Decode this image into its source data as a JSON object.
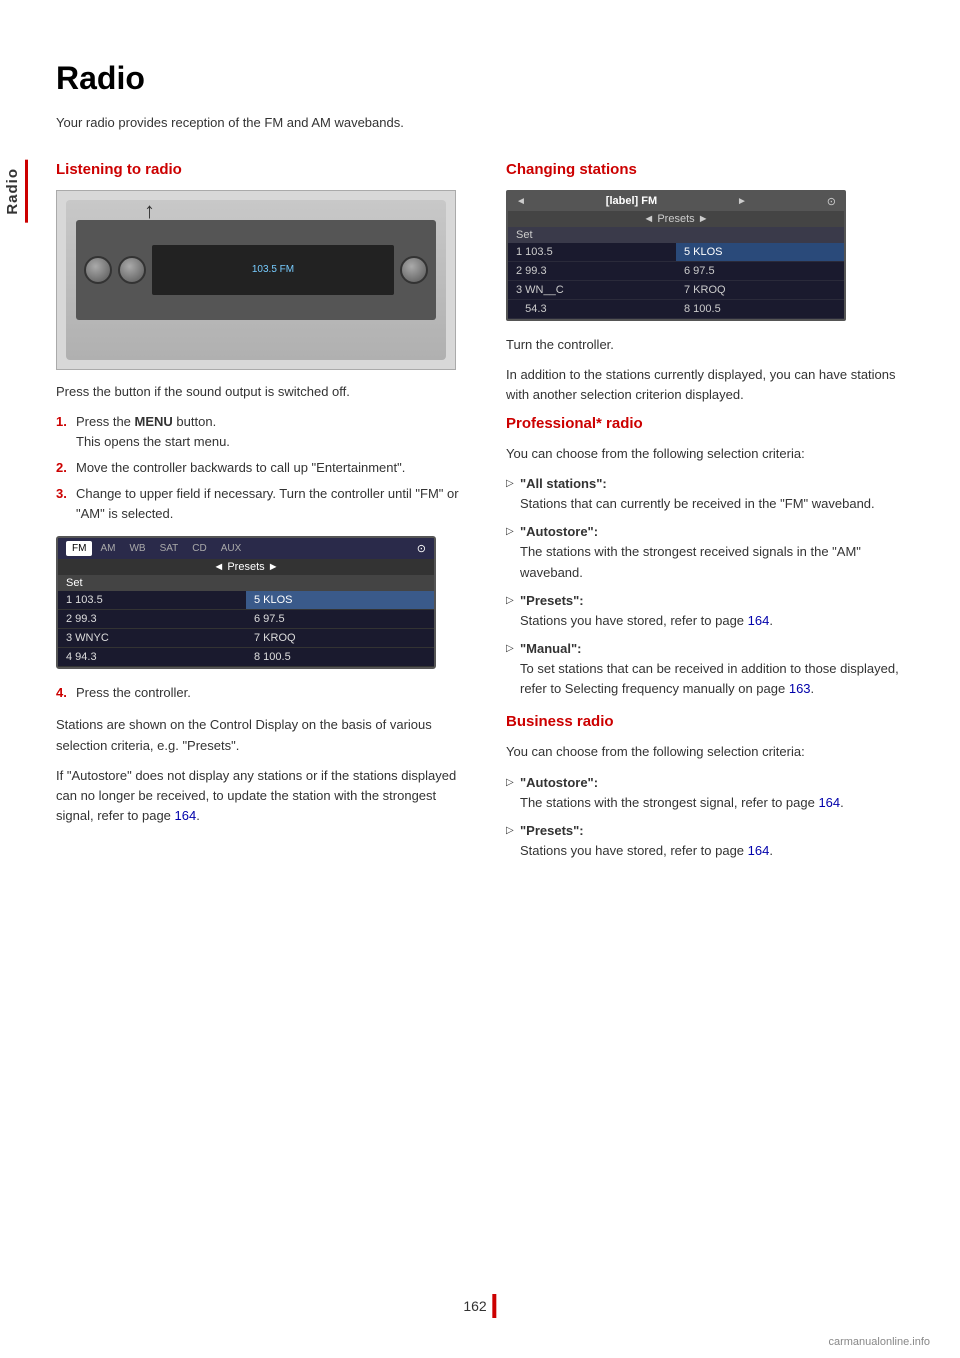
{
  "page": {
    "title": "Radio",
    "side_tab_label": "Radio",
    "page_number": "162",
    "intro": "Your radio provides reception of the FM and AM wavebands."
  },
  "listening_section": {
    "heading": "Listening to radio",
    "body_before_steps": "Press the button if the sound output is switched off.",
    "steps": [
      {
        "num": "1.",
        "text": "Press the ",
        "bold": "MENU",
        "text2": " button.\nThis opens the start menu."
      },
      {
        "num": "2.",
        "text": "Move the controller backwards to call up \"Entertainment\"."
      },
      {
        "num": "3.",
        "text": "Change to upper field if necessary. Turn the controller until \"FM\" or \"AM\" is selected."
      },
      {
        "num": "4.",
        "text": "Press the controller."
      }
    ],
    "after_step4_para1": "Stations are shown on the Control Display on the basis of various selection criteria, e.g. \"Presets\".",
    "after_step4_para2": "If \"Autostore\" does not display any stations or if the stations displayed can no longer be received, to update the station with the strongest signal, refer to page 164.",
    "link1": "164"
  },
  "screen1": {
    "tabs": [
      "FM",
      "AM",
      "WB",
      "SAT",
      "CD",
      "AUX"
    ],
    "active_tab": "FM",
    "presets_label": "◄ Presets ►",
    "set_label": "Set",
    "stations": [
      {
        "pos": "1",
        "freq": "103.5",
        "side": "left"
      },
      {
        "pos": "5",
        "freq": "KLOS",
        "side": "right"
      },
      {
        "pos": "2",
        "freq": "99.3",
        "side": "left"
      },
      {
        "pos": "6",
        "freq": "97.5",
        "side": "right"
      },
      {
        "pos": "3",
        "freq": "WNYC",
        "side": "left"
      },
      {
        "pos": "7",
        "freq": "KROQ",
        "side": "right"
      },
      {
        "pos": "4",
        "freq": "94.3",
        "side": "left"
      },
      {
        "pos": "8",
        "freq": "100.5",
        "side": "right"
      }
    ]
  },
  "changing_section": {
    "heading": "Changing stations",
    "instruction": "Turn the controller.",
    "description": "In addition to the stations currently displayed, you can have stations with another selection criterion displayed."
  },
  "screen2": {
    "top_left": "◄ [label] FM ►",
    "presets_label": "◄ Presets ►",
    "set_label": "Set",
    "stations_left": [
      "1  103.5",
      "2  99.3",
      "3  WN__C",
      "   54.3"
    ],
    "stations_right": [
      "5  KLOS",
      "6  97.5",
      "7  KROQ",
      "8  100.5"
    ]
  },
  "professional_radio": {
    "heading": "Professional* radio",
    "intro": "You can choose from the following selection criteria:",
    "bullets": [
      {
        "title": "\"All stations\":",
        "body": "Stations that can currently be received in the \"FM\" waveband."
      },
      {
        "title": "\"Autostore\":",
        "body": "The stations with the strongest received signals in the \"AM\" waveband."
      },
      {
        "title": "\"Presets\":",
        "body": "Stations you have stored, refer to page 164.",
        "link": "164"
      },
      {
        "title": "\"Manual\":",
        "body": "To set stations that can be received in addition to those displayed, refer to Selecting frequency manually on page 163.",
        "link": "163"
      }
    ]
  },
  "business_radio": {
    "heading": "Business radio",
    "intro": "You can choose from the following selection criteria:",
    "bullets": [
      {
        "title": "\"Autostore\":",
        "body": "The stations with the strongest signal, refer to page 164.",
        "link": "164"
      },
      {
        "title": "\"Presets\":",
        "body": "Stations you have stored, refer to page 164.",
        "link": "164"
      }
    ]
  },
  "watermark": "carmanualonline.info"
}
